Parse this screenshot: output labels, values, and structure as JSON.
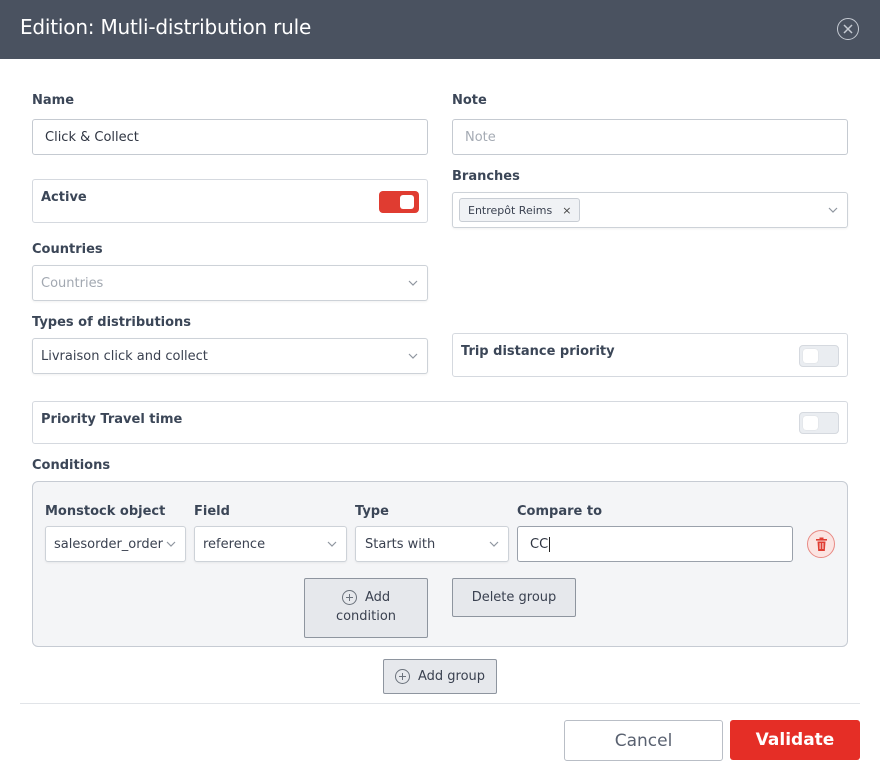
{
  "modal": {
    "title": "Edition: Mutli-distribution rule"
  },
  "form": {
    "name": {
      "label": "Name",
      "value": "Click & Collect"
    },
    "note": {
      "label": "Note",
      "placeholder": "Note"
    },
    "active": {
      "label": "Active",
      "enabled": true
    },
    "branches": {
      "label": "Branches",
      "tags": [
        "Entrepôt Reims"
      ],
      "remove_glyph": "×"
    },
    "countries": {
      "label": "Countries",
      "placeholder": "Countries"
    },
    "types_of_distributions": {
      "label": "Types of distributions",
      "value": "Livraison click and collect"
    },
    "trip_distance_priority": {
      "label": "Trip distance priority",
      "enabled": false
    },
    "priority_travel_time": {
      "label": "Priority Travel time",
      "enabled": false
    }
  },
  "conditions": {
    "label": "Conditions",
    "columns": {
      "object": "Monstock object",
      "field": "Field",
      "type": "Type",
      "compare": "Compare to"
    },
    "rows": [
      {
        "object": "salesorder_order",
        "field": "reference",
        "type": "Starts with",
        "compare": "CC"
      }
    ],
    "add_condition_label": "Add condition",
    "add_condition_line1": "Add",
    "add_condition_line2": "condition",
    "delete_group_label": "Delete group",
    "add_group_label": "Add group"
  },
  "footer": {
    "cancel_label": "Cancel",
    "validate_label": "Validate"
  },
  "colors": {
    "header_bg": "#4a5260",
    "accent_red": "#e52e26",
    "toggle_on": "#e03c31"
  },
  "icons": {
    "close": "close-circle-icon",
    "chevron": "chevron-down-icon",
    "trash": "trash-icon",
    "plus": "plus-circle-icon"
  }
}
